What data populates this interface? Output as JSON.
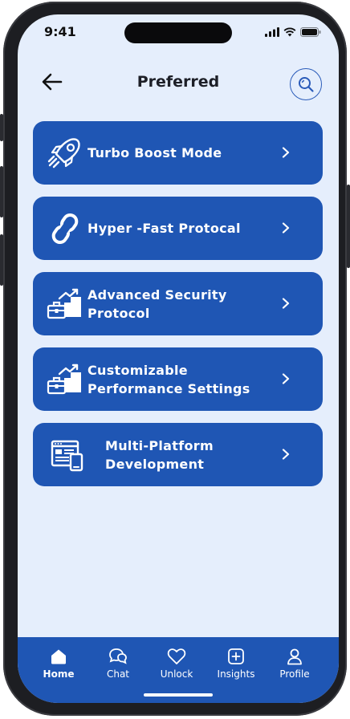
{
  "status": {
    "time": "9:41"
  },
  "header": {
    "title": "Preferred"
  },
  "menu": {
    "items": [
      {
        "label": "Turbo Boost Mode",
        "icon": "rocket-icon"
      },
      {
        "label": "Hyper -Fast Protocal",
        "icon": "link-icon"
      },
      {
        "label": "Advanced Security Protocol",
        "icon": "growth-briefcase-icon"
      },
      {
        "label": "Customizable Performance Settings",
        "icon": "growth-briefcase-icon"
      },
      {
        "label": "Multi-Platform Development",
        "icon": "multi-device-icon"
      }
    ]
  },
  "tabbar": {
    "tabs": [
      {
        "label": "Home",
        "icon": "home-icon",
        "active": true
      },
      {
        "label": "Chat",
        "icon": "chat-icon",
        "active": false
      },
      {
        "label": "Unlock",
        "icon": "heart-icon",
        "active": false
      },
      {
        "label": "Insights",
        "icon": "plus-square-icon",
        "active": false
      },
      {
        "label": "Profile",
        "icon": "user-icon",
        "active": false
      }
    ]
  },
  "colors": {
    "accent": "#1f56b4",
    "background": "#e5eefc",
    "text": "#1d1f27"
  }
}
